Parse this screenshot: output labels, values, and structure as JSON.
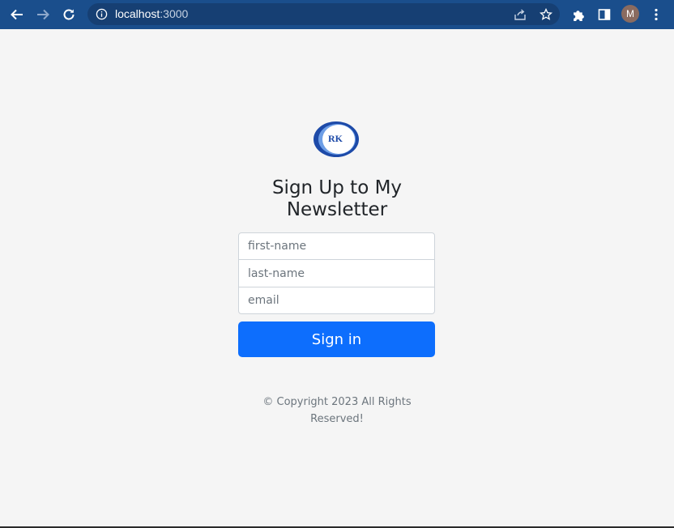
{
  "browser": {
    "url_host": "localhost",
    "url_port": ":3000",
    "profile_initial": "M",
    "theme_color": "#1a4e8c"
  },
  "icons": {
    "back": "arrow-left-icon",
    "forward": "arrow-right-icon",
    "reload": "reload-icon",
    "site_info": "info-icon",
    "share": "share-icon",
    "bookmark": "star-icon",
    "extensions": "puzzle-icon",
    "side_panel": "side-panel-icon",
    "menu": "kebab-menu-icon"
  },
  "page": {
    "logo_text": "RK",
    "title": "Sign Up to My Newsletter",
    "fields": {
      "first_name_placeholder": "first-name",
      "last_name_placeholder": "last-name",
      "email_placeholder": "email"
    },
    "submit_label": "Sign in",
    "footer": "© Copyright 2023 All Rights Reserved!",
    "accent_color": "#0d6efd"
  }
}
